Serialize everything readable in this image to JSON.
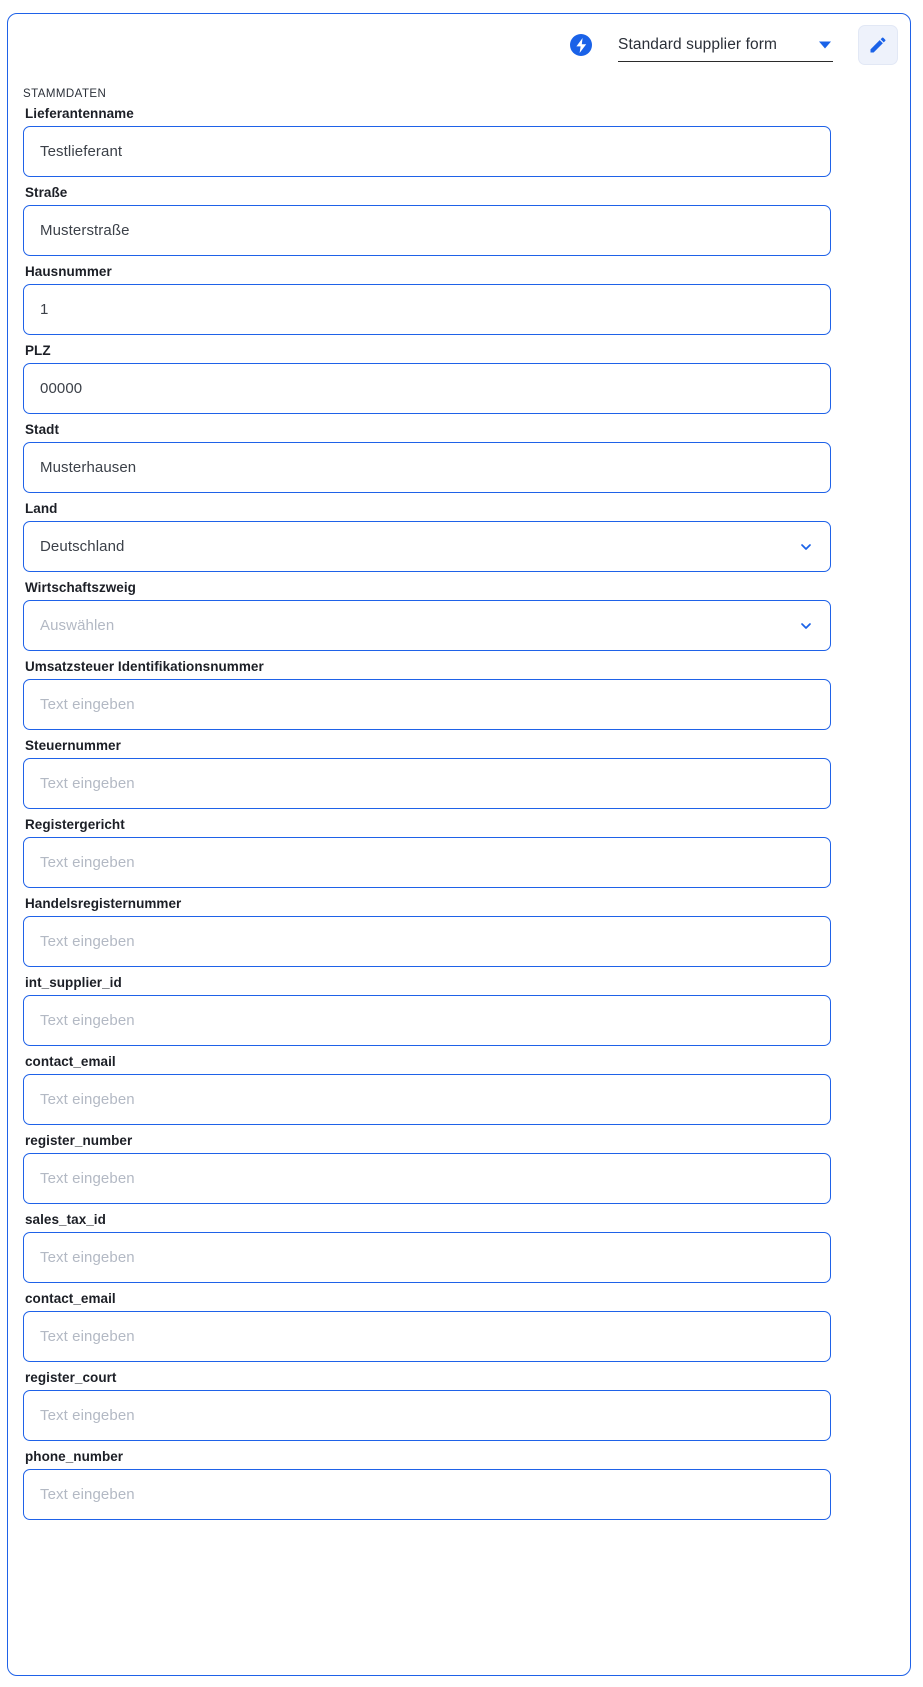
{
  "header": {
    "bolt_icon": "lightning-bolt-icon",
    "form_select_value": "Standard supplier form",
    "caret_icon": "caret-down-icon",
    "edit_icon": "pencil-edit-icon"
  },
  "section": {
    "label": "STAMMDATEN"
  },
  "colors": {
    "accent_blue": "#1f62e8",
    "border_blue": "#1f62e8",
    "placeholder_gray": "#b3b9c4",
    "value_gray": "#3c4149",
    "edit_button_bg": "#eef2fb"
  },
  "placeholders": {
    "text": "Text eingeben",
    "select": "Auswählen"
  },
  "fields": [
    {
      "label": "Lieferantenname",
      "value": "Testlieferant",
      "type": "text",
      "filled": true
    },
    {
      "label": "Straße",
      "value": "Musterstraße",
      "type": "text",
      "filled": true
    },
    {
      "label": "Hausnummer",
      "value": "1",
      "type": "text",
      "filled": true
    },
    {
      "label": "PLZ",
      "value": "00000",
      "type": "text",
      "filled": true
    },
    {
      "label": "Stadt",
      "value": "Musterhausen",
      "type": "text",
      "filled": true
    },
    {
      "label": "Land",
      "value": "Deutschland",
      "type": "select",
      "filled": true
    },
    {
      "label": "Wirtschaftszweig",
      "value": "Auswählen",
      "type": "select",
      "filled": false
    },
    {
      "label": "Umsatzsteuer Identifikationsnummer",
      "value": "Text eingeben",
      "type": "text",
      "filled": false
    },
    {
      "label": "Steuernummer",
      "value": "Text eingeben",
      "type": "text",
      "filled": false
    },
    {
      "label": "Registergericht",
      "value": "Text eingeben",
      "type": "text",
      "filled": false
    },
    {
      "label": "Handelsregisternummer",
      "value": "Text eingeben",
      "type": "text",
      "filled": false
    },
    {
      "label": "int_supplier_id",
      "value": "Text eingeben",
      "type": "text",
      "filled": false
    },
    {
      "label": "contact_email",
      "value": "Text eingeben",
      "type": "text",
      "filled": false
    },
    {
      "label": "register_number",
      "value": "Text eingeben",
      "type": "text",
      "filled": false
    },
    {
      "label": "sales_tax_id",
      "value": "Text eingeben",
      "type": "text",
      "filled": false
    },
    {
      "label": "contact_email",
      "value": "Text eingeben",
      "type": "text",
      "filled": false
    },
    {
      "label": "register_court",
      "value": "Text eingeben",
      "type": "text",
      "filled": false
    },
    {
      "label": "phone_number",
      "value": "Text eingeben",
      "type": "text",
      "filled": false
    }
  ]
}
